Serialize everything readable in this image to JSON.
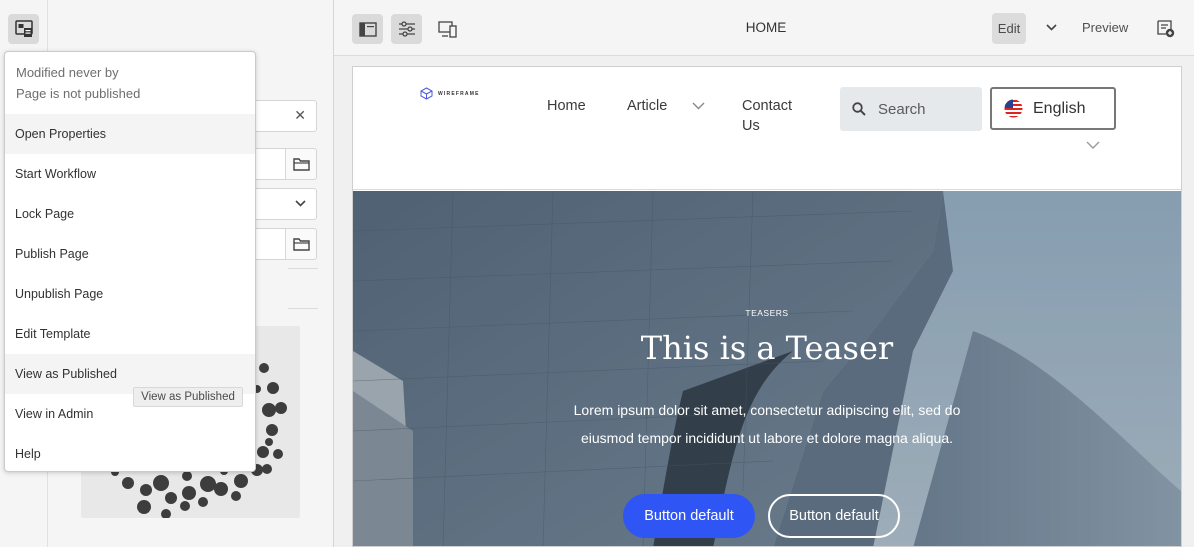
{
  "popover": {
    "status_line1": "Modified never by",
    "status_line2": "Page is not published",
    "items": [
      {
        "label": "Open Properties"
      },
      {
        "label": "Start Workflow"
      },
      {
        "label": "Lock Page"
      },
      {
        "label": "Publish Page"
      },
      {
        "label": "Unpublish Page"
      },
      {
        "label": "Edit Template"
      },
      {
        "label": "View as Published"
      },
      {
        "label": "View in Admin"
      },
      {
        "label": "Help"
      }
    ],
    "tooltip": "View as Published"
  },
  "toolbar": {
    "page_title": "HOME",
    "edit_label": "Edit",
    "preview_label": "Preview"
  },
  "site": {
    "logo_text": "WIREFRAME",
    "nav": {
      "home": "Home",
      "article": "Article",
      "contact_line1": "Contact",
      "contact_line2": "Us"
    },
    "search_placeholder": "Search",
    "language": "English"
  },
  "hero": {
    "eyebrow": "TEASERS",
    "title": "This is a Teaser",
    "description": "Lorem ipsum dolor sit amet, consectetur adipiscing elit, sed do eiusmod tempor incididunt ut labore et dolore magna aliqua.",
    "primary_button": "Button default",
    "secondary_button": "Button default"
  },
  "colors": {
    "accent": "#2f55f5",
    "toolbar_bg": "#f5f5f5"
  },
  "icons": {
    "page_info": "page-info-icon",
    "side_panel": "side-panel-icon",
    "properties": "sliders-icon",
    "emulator": "devices-icon",
    "annotate": "annotate-icon"
  }
}
